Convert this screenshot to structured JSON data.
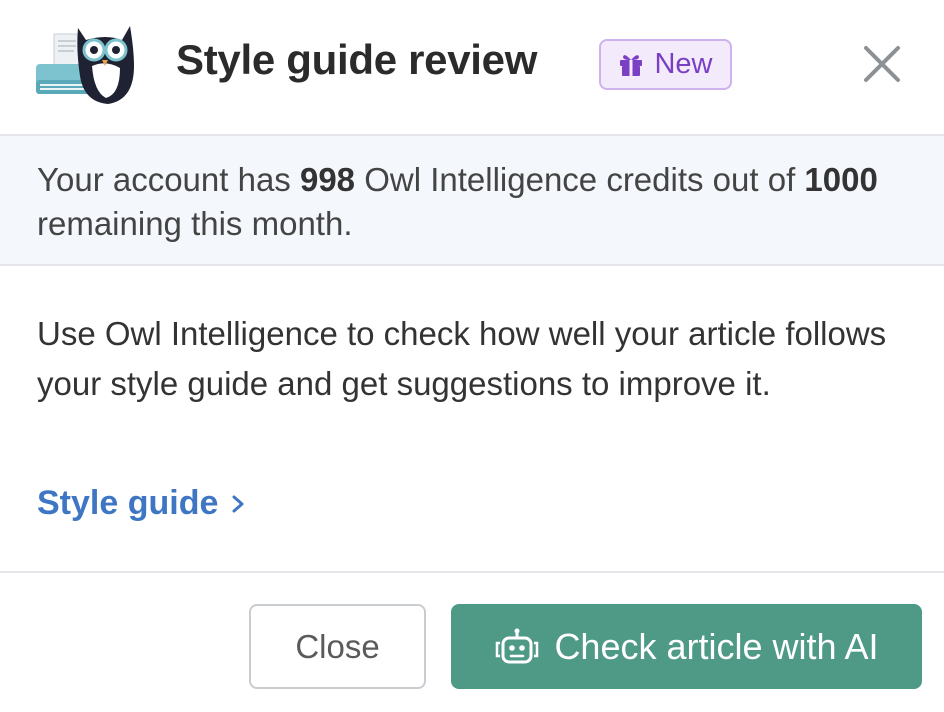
{
  "dialog": {
    "title": "Style guide review",
    "badge": "New",
    "icons": {
      "logo": "owl-logo-icon",
      "badge": "gift-icon",
      "close": "close-icon",
      "link": "chevron-right-icon",
      "action": "robot-icon"
    }
  },
  "credits": {
    "prefix": "Your account has ",
    "used": "998",
    "middle": " Owl Intelligence credits out of ",
    "total": "1000",
    "suffix": " remaining this month."
  },
  "body": {
    "description": "Use Owl Intelligence to check how well your article follows your style guide and get suggestions to improve it.",
    "link_label": "Style guide"
  },
  "footer": {
    "close_label": "Close",
    "check_label": "Check article with AI"
  },
  "colors": {
    "accent": "#4f9a87",
    "link": "#3f76c4",
    "badge_text": "#7b3fc4",
    "badge_bg": "#f3ebfb",
    "info_bg": "#f4f8fc"
  }
}
